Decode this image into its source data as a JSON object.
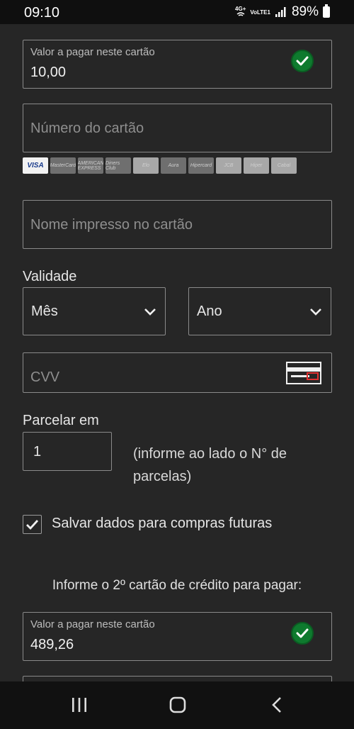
{
  "status_bar": {
    "time": "09:10",
    "network_top": "4G+",
    "network_bottom": "VoLTE1",
    "battery": "89%"
  },
  "card1": {
    "amount_label": "Valor a pagar neste cartão",
    "amount_value": "10,00",
    "card_number_placeholder": "Número do cartão",
    "card_brands": [
      "VISA",
      "MasterCard",
      "AMERICAN EXPRESS",
      "Diners Club",
      "Elo",
      "Aura",
      "Hipercard",
      "JCB",
      "Hiper",
      "Cabal"
    ],
    "name_placeholder": "Nome impresso no cartão",
    "validity_label": "Validade",
    "month_select": "Mês",
    "year_select": "Ano",
    "cvv_placeholder": "CVV",
    "installments_label": "Parcelar em",
    "installments_value": "1",
    "installments_hint": "(informe ao lado o N° de parcelas)",
    "save_data_label": "Salvar dados para compras futuras",
    "save_data_checked": true
  },
  "card2": {
    "title": "Informe o 2º cartão de crédito para pagar:",
    "amount_label": "Valor a pagar neste cartão",
    "amount_value": "489,26"
  },
  "colors": {
    "background": "#262626",
    "border": "#8a8a8a",
    "check_green": "#0e7a2e"
  }
}
